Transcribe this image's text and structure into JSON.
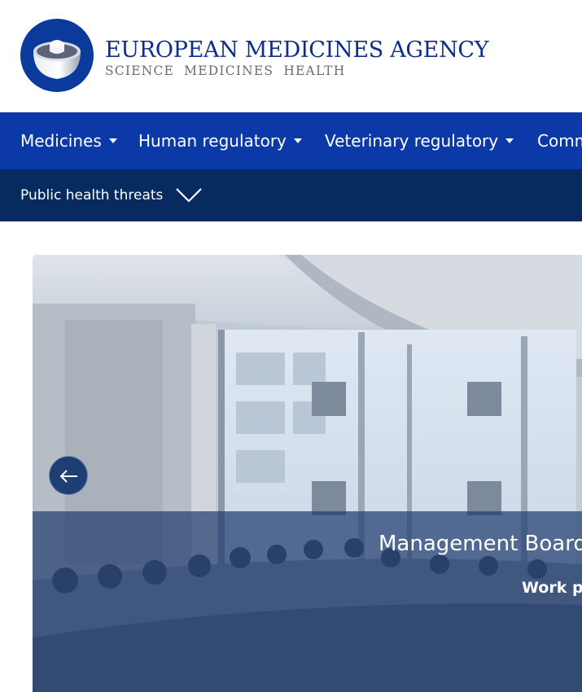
{
  "header": {
    "agency_name": "EUROPEAN MEDICINES AGENCY",
    "tagline": "SCIENCE MEDICINES HEALTH",
    "logo_icon": "ema-logo-icon"
  },
  "main_nav": {
    "items": [
      {
        "label": "Medicines"
      },
      {
        "label": "Human regulatory"
      },
      {
        "label": "Veterinary regulatory"
      },
      {
        "label": "Comm"
      }
    ]
  },
  "sub_nav": {
    "items": [
      {
        "label": "Public health threats"
      }
    ]
  },
  "hero": {
    "title": "Management Board:",
    "subtitle": "Work pr",
    "prev_icon": "arrow-left-icon"
  },
  "colors": {
    "brand_blue": "#0b3aa8",
    "dark_blue": "#072b5e",
    "logo_blue": "#0a3a9c"
  }
}
